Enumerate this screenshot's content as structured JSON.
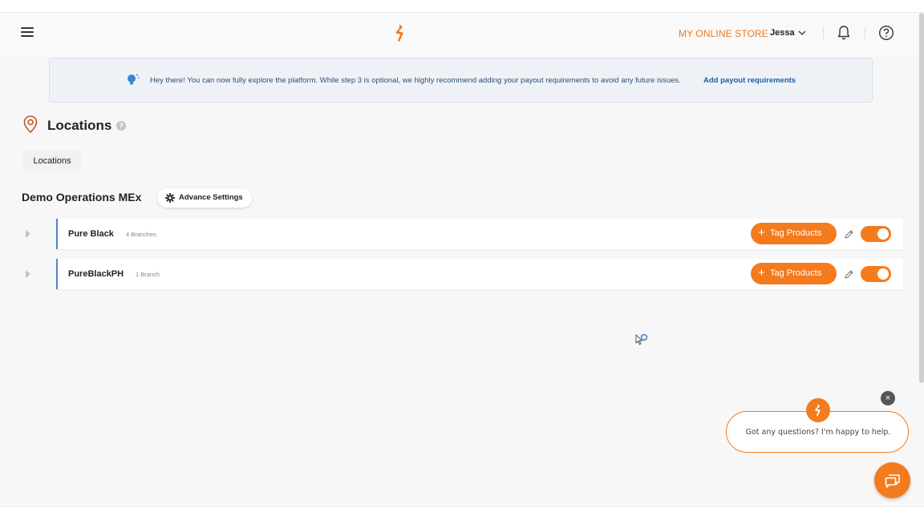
{
  "header": {
    "store_name": "MY ONLINE STORE",
    "user_name": "Jessa",
    "menu_icon": "hamburger-icon",
    "logo_icon": "brand-logo-icon",
    "bell_icon": "bell-icon",
    "help_icon": "help-circle-icon"
  },
  "banner": {
    "text": "Hey there! You can now fully explore the platform. While step 3 is optional, we highly recommend adding your payout requirements to avoid any future issues.",
    "link": "Add payout requirements",
    "icon": "lightbulb-icon"
  },
  "page": {
    "title": "Locations",
    "help_badge": "?",
    "tab_label": "Locations"
  },
  "group": {
    "title": "Demo Operations MEx",
    "advance_settings": "Advance Settings"
  },
  "rows": [
    {
      "name": "Pure Black",
      "count": "4 Branches",
      "tag_label": "Tag Products",
      "enabled": true
    },
    {
      "name": "PureBlackPH",
      "count": "1 Branch",
      "tag_label": "Tag Products",
      "enabled": true
    }
  ],
  "buttons": {
    "plus": "+"
  },
  "chat": {
    "message": "Got any questions? I'm happy to help.",
    "close": "×"
  },
  "colors": {
    "accent": "#f47b1e",
    "banner_bg": "#eef2f7",
    "row_border": "#4f86c6",
    "link": "#1d5fa3"
  }
}
